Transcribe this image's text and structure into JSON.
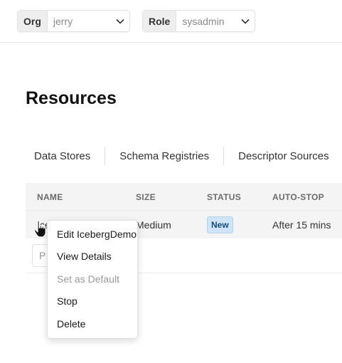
{
  "org": {
    "label": "Org",
    "value": "jerry"
  },
  "role": {
    "label": "Role",
    "value": "sysadmin"
  },
  "page": {
    "title": "Resources"
  },
  "tabs": [
    {
      "label": "Data Stores"
    },
    {
      "label": "Schema Registries"
    },
    {
      "label": "Descriptor Sources"
    }
  ],
  "table": {
    "columns": [
      "NAME",
      "SIZE",
      "STATUS",
      "AUTO-STOP"
    ],
    "rows": [
      {
        "name": "Ice",
        "size": "Medium",
        "status": "New",
        "auto_stop": "After 15 mins"
      }
    ],
    "page_input_placeholder": "P"
  },
  "context_menu": {
    "items": [
      {
        "label": "Edit IcebergDemo",
        "enabled": true
      },
      {
        "label": "View Details",
        "enabled": true
      },
      {
        "label": "Set as Default",
        "enabled": false
      },
      {
        "label": "Stop",
        "enabled": true
      },
      {
        "label": "Delete",
        "enabled": true
      }
    ]
  },
  "colors": {
    "badge_bg": "#cfe4f6",
    "badge_text": "#124a7a",
    "header_bg": "#f4f4f4"
  },
  "icons": {
    "dropdown": "chevron-down-icon",
    "cursor": "hand-pointer-icon"
  }
}
